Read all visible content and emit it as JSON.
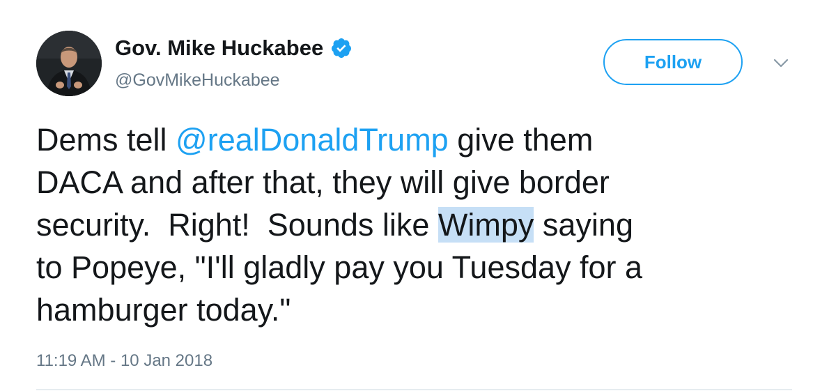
{
  "tweet": {
    "author": {
      "display_name": "Gov. Mike Huckabee",
      "handle": "@GovMikeHuckabee",
      "verified": true,
      "avatar_icon": "avatar-photo"
    },
    "follow_label": "Follow",
    "menu_icon": "chevron-down-icon",
    "text_lines": [
      {
        "before": "Dems tell ",
        "mention": "@realDonaldTrump",
        "after": " give them"
      },
      {
        "text": "DACA and after that, they will give border"
      },
      {
        "before": "security.  Right!  Sounds like ",
        "highlight": "Wimpy",
        "after": " saying"
      },
      {
        "text": "to Popeye, \"I'll gladly pay you Tuesday for a"
      },
      {
        "text": "hamburger today.\""
      }
    ],
    "timestamp": "11:19 AM - 10 Jan 2018"
  },
  "colors": {
    "accent": "#1da1f2",
    "text": "#14171a",
    "secondary_text": "#657786",
    "highlight": "#c6dff6",
    "divider": "#e6ecf0"
  }
}
